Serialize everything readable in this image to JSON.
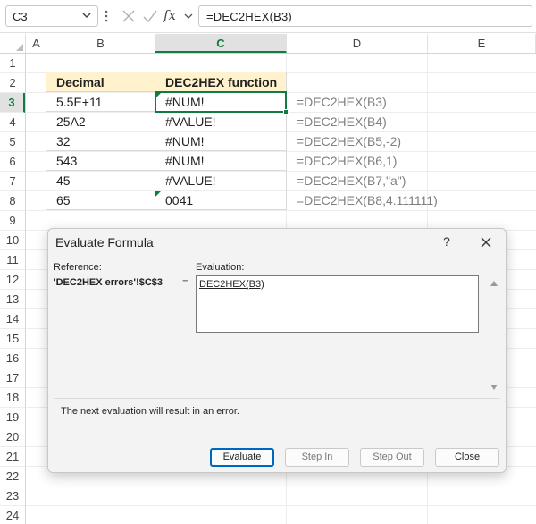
{
  "formula_bar": {
    "name_box": "C3",
    "fx_label": "fx",
    "formula": "=DEC2HEX(B3)"
  },
  "columns": [
    "A",
    "B",
    "C",
    "D",
    "E"
  ],
  "selected_column": "C",
  "rows": [
    "1",
    "2",
    "3",
    "4",
    "5",
    "6",
    "7",
    "8",
    "9",
    "10",
    "11",
    "12",
    "13",
    "14",
    "15",
    "16",
    "17",
    "18",
    "19",
    "20",
    "21",
    "22",
    "23",
    "24"
  ],
  "selected_row": "3",
  "table": {
    "headers": [
      "Decimal",
      "DEC2HEX function"
    ],
    "rows": [
      {
        "b": "5.5E+11",
        "c": "#NUM!",
        "d": "=DEC2HEX(B3)"
      },
      {
        "b": "25A2",
        "c": "#VALUE!",
        "d": "=DEC2HEX(B4)"
      },
      {
        "b": "32",
        "c": "#NUM!",
        "d": "=DEC2HEX(B5,-2)"
      },
      {
        "b": "543",
        "c": "#NUM!",
        "d": "=DEC2HEX(B6,1)"
      },
      {
        "b": "45",
        "c": "#VALUE!",
        "d": "=DEC2HEX(B7,\"a\")"
      },
      {
        "b": "65",
        "c": "0041",
        "d": "=DEC2HEX(B8,4.111111)"
      }
    ]
  },
  "dialog": {
    "title": "Evaluate Formula",
    "help": "?",
    "reference_label": "Reference:",
    "reference_value": "'DEC2HEX errors'!$C$3",
    "equals": "=",
    "evaluation_label": "Evaluation:",
    "evaluation_value": "DEC2HEX(B3)",
    "message": "The next evaluation will result in an error.",
    "buttons": {
      "evaluate": "Evaluate",
      "step_in": "Step In",
      "step_out": "Step Out",
      "close": "Close"
    }
  },
  "colors": {
    "accent": "#107c41",
    "header_fill": "#fff2cc",
    "primary_button_border": "#0067c0"
  }
}
